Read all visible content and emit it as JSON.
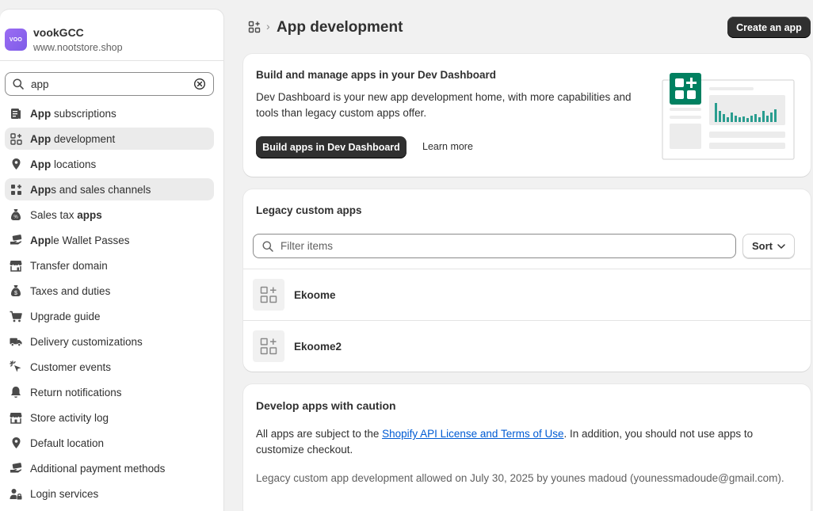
{
  "store": {
    "initials": "VOO",
    "name": "vookGCC",
    "domain": "www.nootstore.shop",
    "avatar_color": "#8a63ee"
  },
  "search": {
    "value": "app",
    "icon": "search-icon",
    "clear_icon": "clear-circle-icon"
  },
  "sidebar": {
    "items": [
      {
        "bold": "App",
        "rest": " subscriptions",
        "icon": "receipt-icon",
        "selected": false
      },
      {
        "bold": "App",
        "rest": " development",
        "icon": "apps-icon",
        "selected": true
      },
      {
        "bold": "App",
        "rest": " locations",
        "icon": "location-icon",
        "selected": false
      },
      {
        "bold": "App",
        "rest": "s and sales channels",
        "icon": "apps-filled-icon",
        "selected": true
      },
      {
        "pre": "Sales tax ",
        "bold": "apps",
        "icon": "tax-bag-icon",
        "selected": false
      },
      {
        "bold": "App",
        "rest": "le Wallet Passes",
        "icon": "hand-card-icon",
        "selected": false
      },
      {
        "pre": "Transfer domain",
        "icon": "store-icon",
        "selected": false
      },
      {
        "pre": "Taxes and duties",
        "icon": "money-bag-icon",
        "selected": false
      },
      {
        "pre": "Upgrade guide",
        "icon": "cart-icon",
        "selected": false
      },
      {
        "pre": "Delivery customizations",
        "icon": "truck-icon",
        "selected": false
      },
      {
        "pre": "Customer events",
        "icon": "cursor-click-icon",
        "selected": false
      },
      {
        "pre": "Return notifications",
        "icon": "bell-icon",
        "selected": false
      },
      {
        "pre": "Store activity log",
        "icon": "store-icon",
        "selected": false
      },
      {
        "pre": "Default location",
        "icon": "location-icon",
        "selected": false
      },
      {
        "pre": "Additional payment methods",
        "icon": "hand-card-icon",
        "selected": false
      },
      {
        "pre": "Login services",
        "icon": "person-lock-icon",
        "selected": false
      }
    ]
  },
  "header": {
    "breadcrumb_icon": "apps-icon",
    "title": "App development",
    "create_button": "Create an app"
  },
  "dev_dashboard": {
    "title": "Build and manage apps in your Dev Dashboard",
    "description": "Dev Dashboard is your new app development home, with more capabilities and tools than legacy custom apps offer.",
    "primary_button": "Build apps in Dev Dashboard",
    "secondary_button": "Learn more",
    "accent_color": "#008060"
  },
  "legacy": {
    "title": "Legacy custom apps",
    "filter_placeholder": "Filter items",
    "sort_label": "Sort",
    "apps": [
      {
        "name": "Ekoome"
      },
      {
        "name": "Ekoome2"
      }
    ]
  },
  "caution": {
    "title": "Develop apps with caution",
    "p1_before": "All apps are subject to the ",
    "p1_link": "Shopify API License and Terms of Use",
    "p1_after": ". In addition, you should not use apps to customize checkout.",
    "p2": "Legacy custom app development allowed on July 30, 2025 by younes madoud (younessmadoude@gmail.com)."
  }
}
